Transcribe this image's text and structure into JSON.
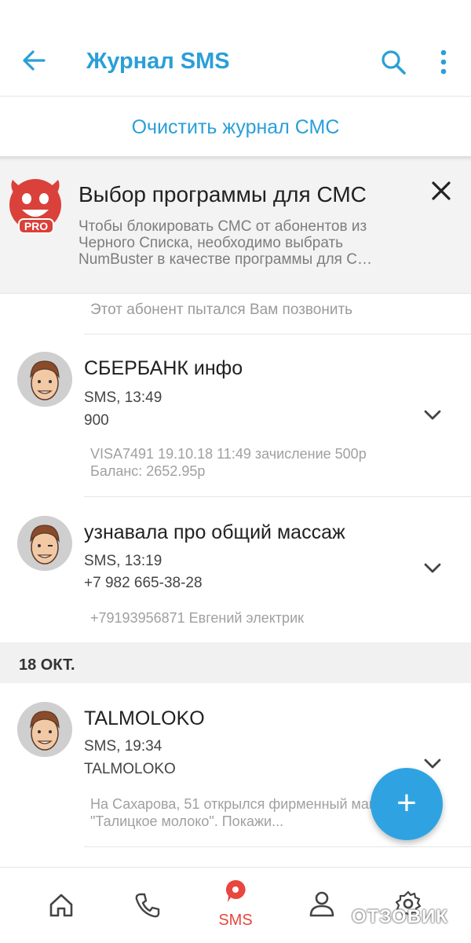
{
  "appbar": {
    "title": "Журнал SMS",
    "icons": [
      "arrow-back-icon",
      "search-icon",
      "more-vert-icon"
    ]
  },
  "clear_log_label": "Очистить журнал СМС",
  "promo": {
    "badge": "PRO",
    "title": "Выбор программы для СМС",
    "text": "Чтобы блокировать СМС от абонентов из Черного Списка, необходимо выбрать NumBuster в качестве программы для С…"
  },
  "previous_preview": "Этот абонент пытался Вам позвонить",
  "messages": [
    {
      "name": "СБЕРБАНК инфо",
      "meta": "SMS, 13:49",
      "number": "900",
      "body": "VISA7491 19.10.18 11:49 зачисление 500р Баланс: 2652.95р"
    },
    {
      "name": "узнавала про общий массаж",
      "meta": "SMS, 13:19",
      "number": "+7 982 665-38-28",
      "body": "+79193956871 Евгений электрик"
    }
  ],
  "date_header": "18 ОКТ.",
  "messages_oct18": [
    {
      "name": "TALMOLOKO",
      "meta": "SMS, 19:34",
      "number": "TALMOLOKO",
      "body": "На Сахарова, 51 открылся фирменный магазин \"Талицкое молоко\". Покажи..."
    }
  ],
  "fab": {
    "label": "+"
  },
  "bottom_nav": {
    "items": [
      {
        "icon": "home-icon",
        "label": ""
      },
      {
        "icon": "phone-icon",
        "label": ""
      },
      {
        "icon": "sms-icon",
        "label": "SMS"
      },
      {
        "icon": "person-icon",
        "label": ""
      },
      {
        "icon": "settings-icon",
        "label": ""
      }
    ]
  },
  "watermark": "ОТЗОВИК",
  "colors": {
    "accent": "#2a9fd8",
    "fab": "#2fa3e2",
    "nav_active": "#e8463f",
    "logo_red": "#d9413a"
  }
}
